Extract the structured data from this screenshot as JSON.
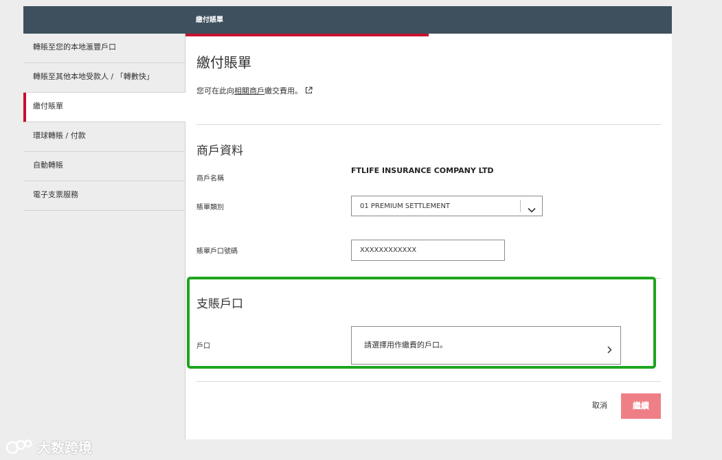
{
  "header": {
    "title": "繳付賬單"
  },
  "sidebar": {
    "items": [
      {
        "label": "轉賬至您的本地滙豐戶口"
      },
      {
        "label": "轉賬至其他本地受款人 / 「轉數快」"
      },
      {
        "label": "繳付賬單"
      },
      {
        "label": "環球轉賬 / 付款"
      },
      {
        "label": "自動轉賬"
      },
      {
        "label": "電子支票服務"
      }
    ],
    "active_index": 2
  },
  "main": {
    "page_title": "繳付賬單",
    "intro_prefix": "您可在此向",
    "intro_link": "相關商戶",
    "intro_suffix": "繳交費用。",
    "merchant_section": {
      "title": "商戶資料",
      "merchant_name_label": "商戶名稱",
      "merchant_name_value": "FTLIFE INSURANCE COMPANY LTD",
      "bill_type_label": "賬單類別",
      "bill_type_value": "01 PREMIUM SETTLEMENT",
      "bill_account_label": "賬單戶口號碼",
      "bill_account_value": "XXXXXXXXXXXX"
    },
    "payment_section": {
      "title": "支賬戶口",
      "account_label": "戶口",
      "account_placeholder": "請選擇用作繳費的戶口。"
    },
    "actions": {
      "cancel_label": "取消",
      "continue_label": "繼續"
    }
  },
  "watermark": {
    "text": "大数跨境"
  },
  "colors": {
    "header_bg": "#3e505d",
    "accent_red": "#c8102e",
    "continue_button": "#ee7f86",
    "highlight_green": "#1ea51e"
  }
}
